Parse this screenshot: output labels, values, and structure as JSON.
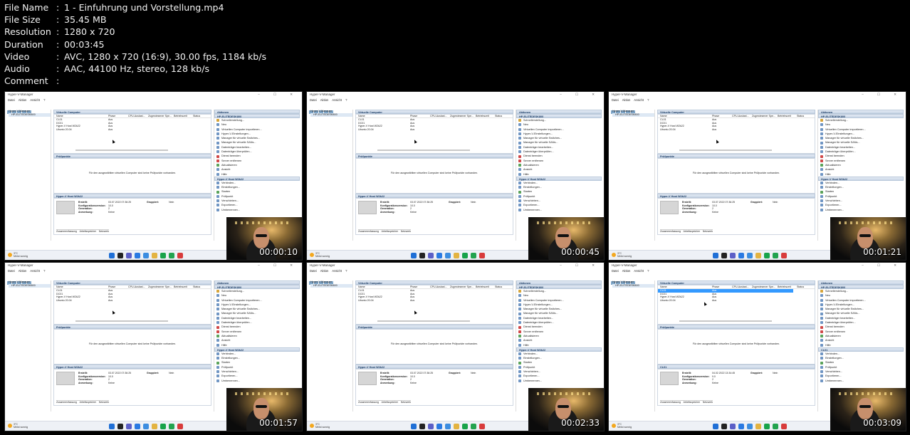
{
  "file_info": [
    {
      "key": "File Name",
      "value": "1 - Einfuhrung und Vorstellung.mp4"
    },
    {
      "key": "File Size",
      "value": "35.45 MB"
    },
    {
      "key": "Resolution",
      "value": "1280 x 720"
    },
    {
      "key": "Duration",
      "value": "00:03:45"
    },
    {
      "key": "Video",
      "value": "AVC, 1280 x 720 (16:9), 30.00 fps, 1184 kb/s"
    },
    {
      "key": "Audio",
      "value": "AAC, 44100 Hz, stereo, 128 kb/s"
    },
    {
      "key": "Comment",
      "value": ""
    }
  ],
  "separator": ":",
  "app": {
    "title": "Hyper-V-Manager",
    "window_controls": "– ☐ ✕",
    "menu": "Datei Aktion Ansicht ?",
    "tree": [
      "Hyper-V-Manager",
      "HP-ELITEDESK800"
    ],
    "vm_section": "Virtuelle Computer",
    "vm_headers": [
      "Name",
      "Phase",
      "CPU-Auslast...",
      "Zugewiesener Spe...",
      "Betriebszeit",
      "Status"
    ],
    "vms": [
      {
        "name": "CL01",
        "phase": "Aus"
      },
      {
        "name": "DC01",
        "phase": "Aus"
      },
      {
        "name": "Hyper-V Host W2k22",
        "phase": "Aus"
      },
      {
        "name": "Ubuntu 20.04",
        "phase": "Aus"
      }
    ],
    "checkpoints_section": "Prüfpunkte",
    "checkpoints_empty": "Für den ausgewählten virtuellen Computer sind keine Prüfpunkte vorhanden.",
    "detail_section": "Hyper-V Host W2k22",
    "detail_section_alt": "CL01",
    "detail_labels": [
      "Erstellt:",
      "Konfigurationsversion:",
      "Generation:",
      "Anmerkung:"
    ],
    "detail_values": [
      "03.07.2022 07:36:25",
      "10.0",
      "2",
      "Keine"
    ],
    "detail_values_alt": [
      "04.02.2022 13:34:45",
      "9.0",
      "2",
      "Keine"
    ],
    "grouped_label": "Gruppiert:",
    "grouped_value": "Nein",
    "detail_tabs": "Zusammenfassung Arbeitsspeicher Netzwerk",
    "actions_section": "Aktionen",
    "actions_host": "HP-ELITEDESK800",
    "actions": [
      "Schnellerstellung...",
      "Neu",
      "Virtuellen Computer importieren...",
      "Hyper-V-Einstellungen...",
      "Manager für virtuelle Switches...",
      "Manager für virtuelle SANs...",
      "Datenträger bearbeiten...",
      "Datenträger überprüfen...",
      "Dienst beenden",
      "Server entfernen",
      "Aktualisieren",
      "Ansicht",
      "Hilfe"
    ],
    "actions_vm_section": "Hyper-V Host W2k22",
    "actions_vm": [
      "Verbinden...",
      "Einstellungen...",
      "Starten",
      "Prüfpunkt",
      "Verschieben...",
      "Exportieren...",
      "Umbenennen..."
    ],
    "weather_temp": "3°C",
    "weather_text": "Meist sonnig",
    "status_text": "HP-ELITEDESK800: Ein virtueller Computer ausgewählt."
  },
  "timestamps": [
    "00:00:10",
    "00:00:45",
    "00:01:21",
    "00:01:57",
    "00:02:33",
    "00:03:09"
  ],
  "taskbar_colors": [
    "#1f6fd6",
    "#222222",
    "#5b5fc7",
    "#2a7ae2",
    "#3c8de0",
    "#e3b341",
    "#18a34a",
    "#22a34f",
    "#d83b3b"
  ]
}
